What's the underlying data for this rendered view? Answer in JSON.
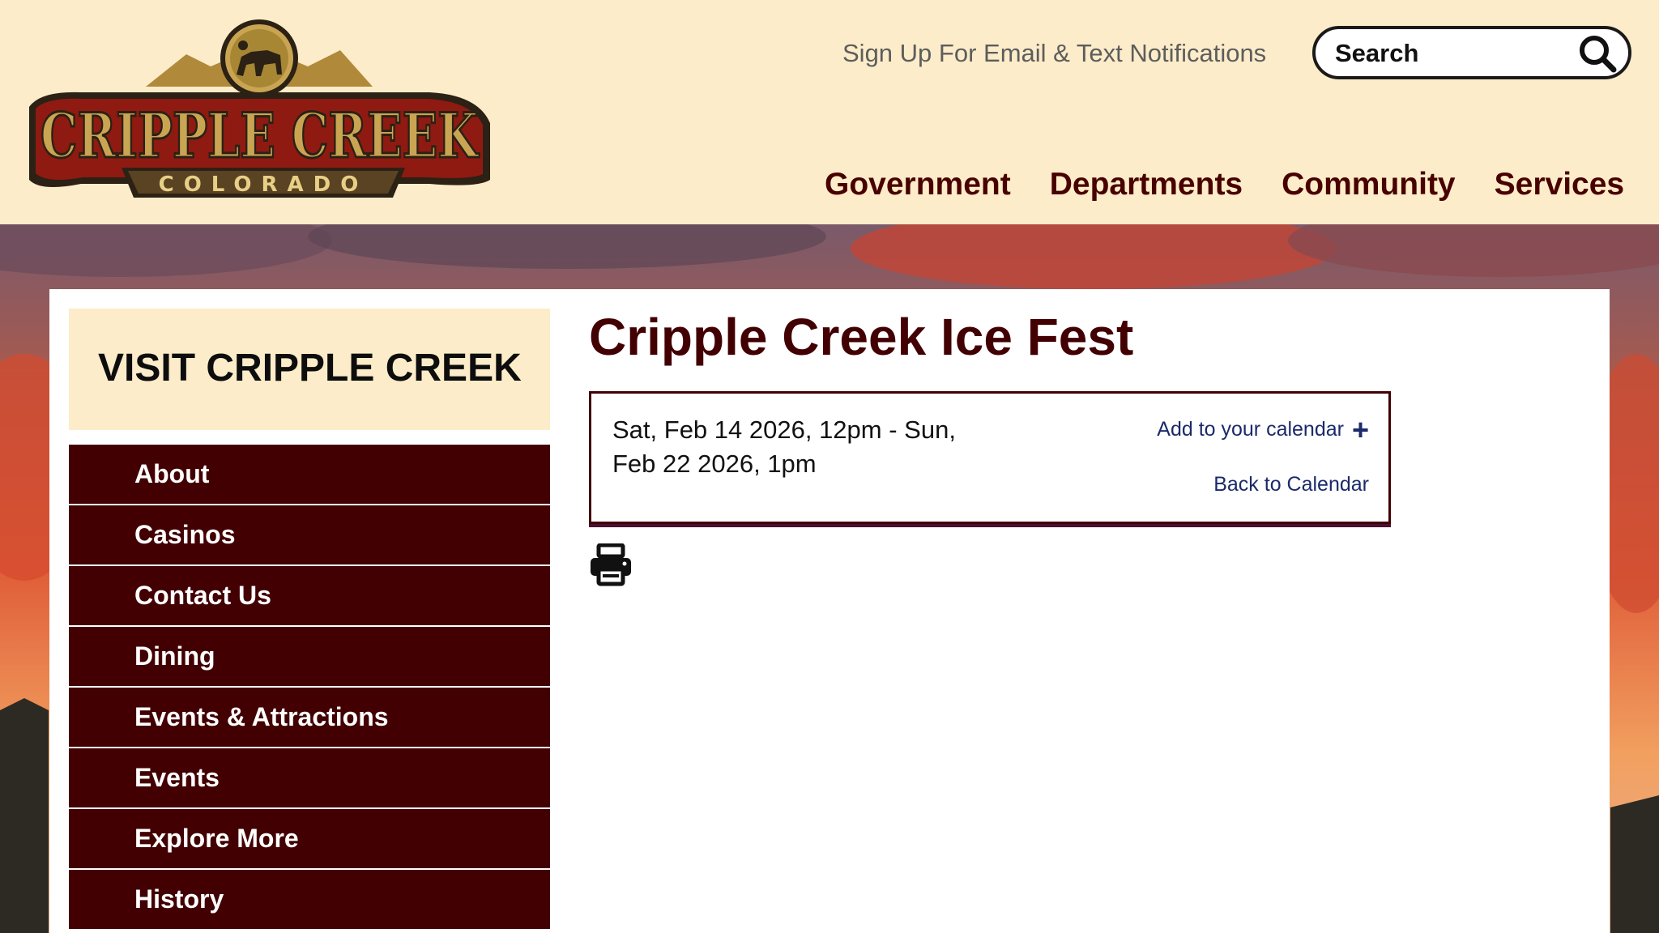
{
  "header": {
    "logo": {
      "title": "CRIPPLE CREEK",
      "subtitle": "COLORADO",
      "colors": {
        "red": "#8e1a12",
        "gold": "#c9a553",
        "dark": "#2b2114"
      }
    },
    "notify_link": "Sign Up For Email & Text Notifications",
    "search": {
      "placeholder": "Search",
      "icon": "search-icon"
    },
    "nav": [
      {
        "label": "Government"
      },
      {
        "label": "Departments"
      },
      {
        "label": "Community"
      },
      {
        "label": "Services"
      }
    ]
  },
  "sidebar": {
    "heading": "VISIT CRIPPLE CREEK",
    "items": [
      {
        "label": "About"
      },
      {
        "label": "Casinos"
      },
      {
        "label": "Contact Us"
      },
      {
        "label": "Dining"
      },
      {
        "label": "Events & Attractions"
      },
      {
        "label": "Events"
      },
      {
        "label": "Explore More"
      },
      {
        "label": "History"
      }
    ]
  },
  "event": {
    "title": "Cripple Creek Ice Fest",
    "date_range": "Sat, Feb 14 2026, 12pm - Sun, Feb 22 2026, 1pm",
    "add_to_calendar": "Add to your calendar",
    "back_to_calendar": "Back to Calendar",
    "print_icon": "printer-icon"
  },
  "colors": {
    "header_bg": "#fcecc9",
    "maroon": "#420003",
    "link_blue": "#1b2a6b",
    "sidebar_head_bg": "#fcecc9"
  }
}
